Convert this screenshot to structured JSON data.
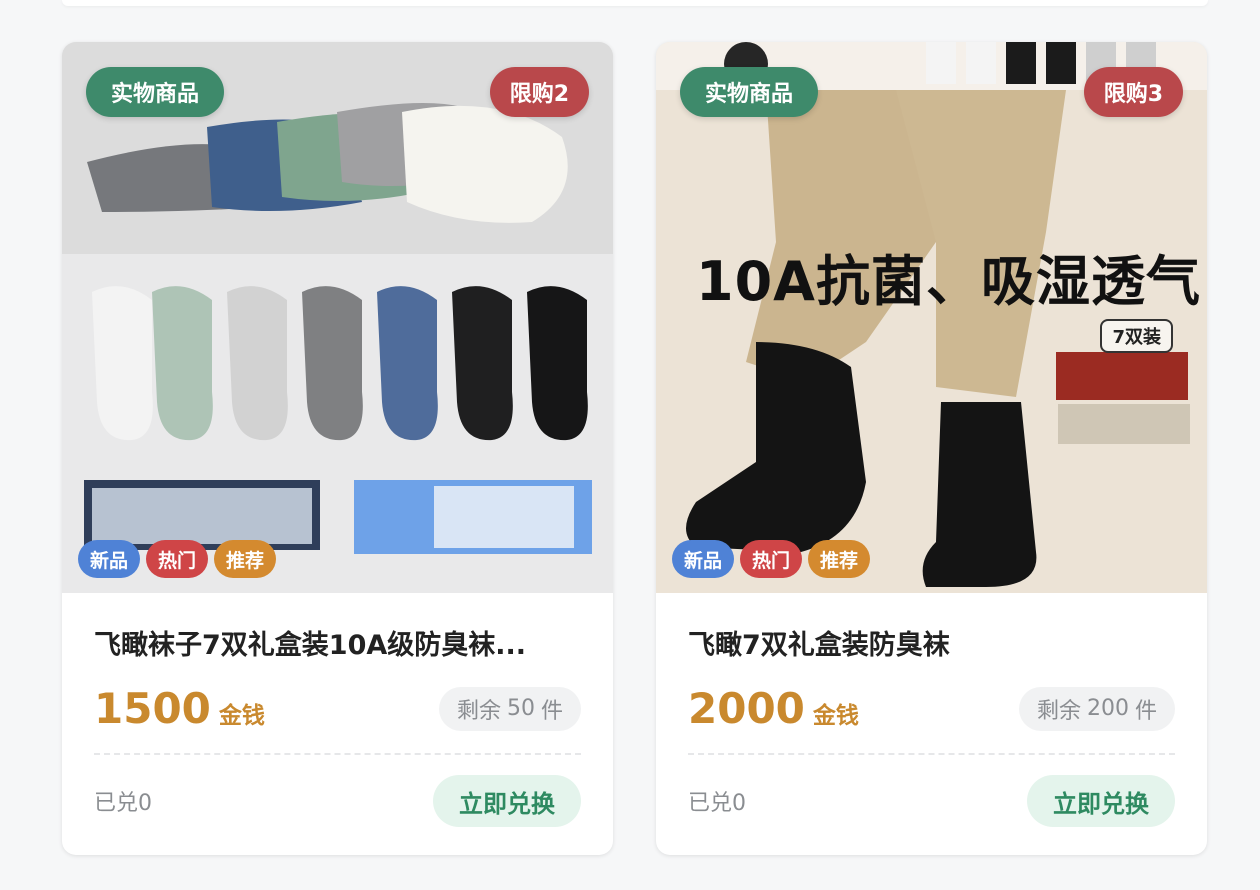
{
  "products": [
    {
      "tag_type": "实物商品",
      "limit": "限购2",
      "chips": [
        "新品",
        "热门",
        "推荐"
      ],
      "title": "飞瞰袜子7双礼盒装10A级防臭袜...",
      "price": "1500",
      "currency": "金钱",
      "stock_prefix": "剩余",
      "stock_count": "50",
      "stock_unit": "件",
      "redeemed": "已兑0",
      "button": "立即兑换"
    },
    {
      "tag_type": "实物商品",
      "limit": "限购3",
      "chips": [
        "新品",
        "热门",
        "推荐"
      ],
      "title": "飞瞰7双礼盒装防臭袜",
      "price": "2000",
      "currency": "金钱",
      "stock_prefix": "剩余",
      "stock_count": "200",
      "stock_unit": "件",
      "redeemed": "已兑0",
      "button": "立即兑换",
      "image_headline": "10A抗菌、吸湿透气",
      "image_pack_label": "7双装"
    }
  ],
  "colors": {
    "accent_green": "#3e8a6b",
    "limit_red": "#b9484b",
    "price_gold": "#c9892e"
  }
}
